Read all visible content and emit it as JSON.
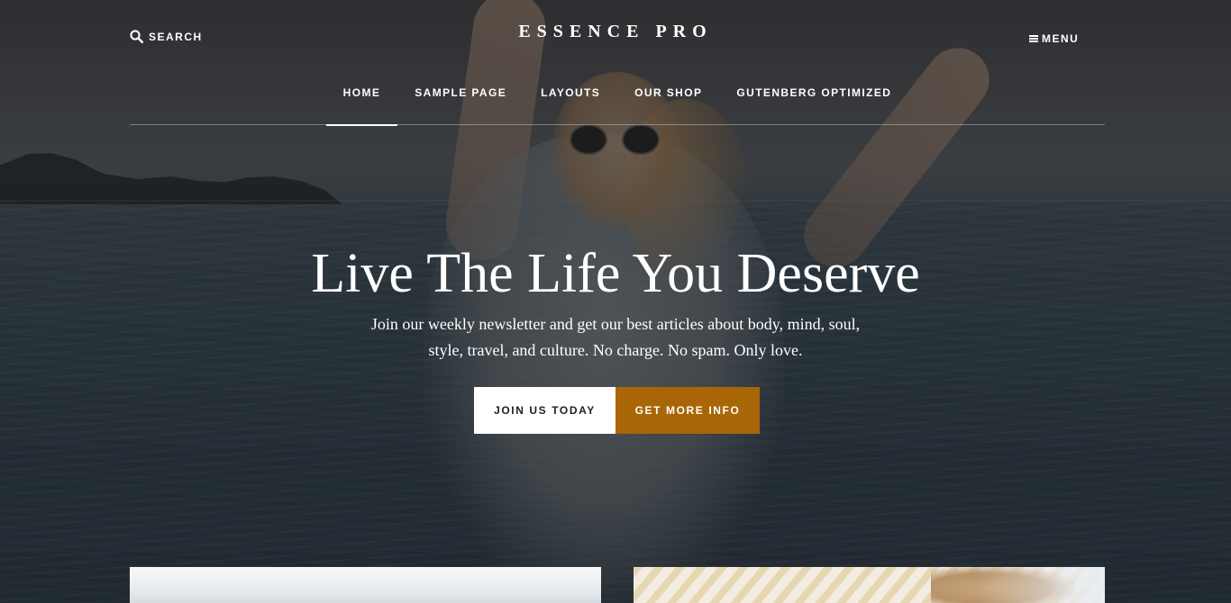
{
  "header": {
    "search_label": "SEARCH",
    "brand": "ESSENCE PRO",
    "menu_label": "MENU"
  },
  "nav": {
    "items": [
      {
        "label": "HOME",
        "active": true
      },
      {
        "label": "SAMPLE PAGE",
        "active": false
      },
      {
        "label": "LAYOUTS",
        "active": false
      },
      {
        "label": "OUR SHOP",
        "active": false
      },
      {
        "label": "GUTENBERG OPTIMIZED",
        "active": false
      }
    ]
  },
  "hero": {
    "title": "Live The Life You Deserve",
    "text_line1": "Join our weekly newsletter and get our best articles about body, mind, soul,",
    "text_line2": "style, travel, and culture. No charge. No spam. Only love.",
    "primary_button": "JOIN US TODAY",
    "secondary_button": "GET MORE INFO"
  },
  "colors": {
    "accent": "#a86606",
    "primary_button_bg": "#ffffff",
    "text": "#ffffff"
  },
  "icons": {
    "search": "search-icon",
    "menu": "hamburger-icon"
  }
}
